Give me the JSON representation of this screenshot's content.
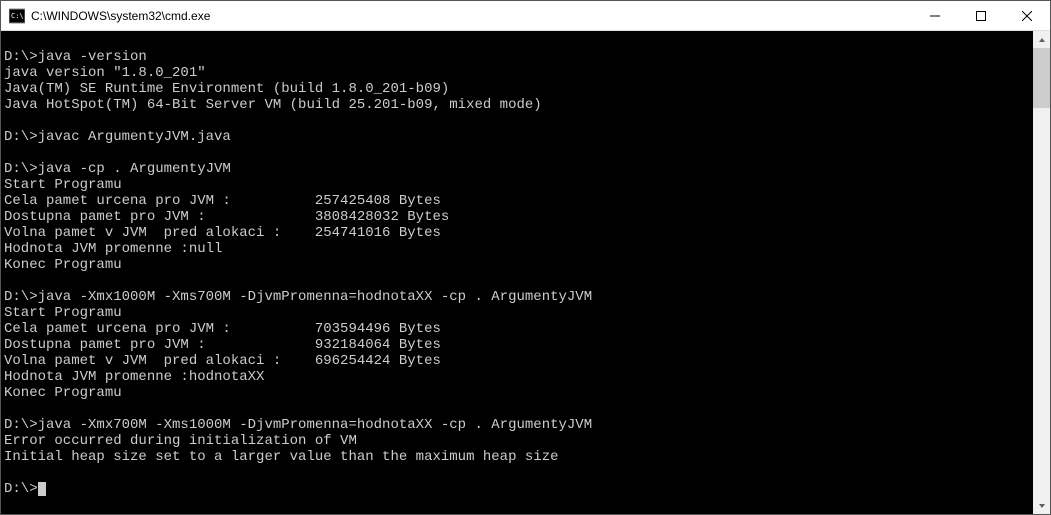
{
  "window": {
    "title": "C:\\WINDOWS\\system32\\cmd.exe"
  },
  "terminal": {
    "lines": [
      "",
      "D:\\>java -version",
      "java version \"1.8.0_201\"",
      "Java(TM) SE Runtime Environment (build 1.8.0_201-b09)",
      "Java HotSpot(TM) 64-Bit Server VM (build 25.201-b09, mixed mode)",
      "",
      "D:\\>javac ArgumentyJVM.java",
      "",
      "D:\\>java -cp . ArgumentyJVM",
      "Start Programu",
      "Cela pamet urcena pro JVM :          257425408 Bytes",
      "Dostupna pamet pro JVM :             3808428032 Bytes",
      "Volna pamet v JVM  pred alokaci :    254741016 Bytes",
      "Hodnota JVM promenne :null",
      "Konec Programu",
      "",
      "D:\\>java -Xmx1000M -Xms700M -DjvmPromenna=hodnotaXX -cp . ArgumentyJVM",
      "Start Programu",
      "Cela pamet urcena pro JVM :          703594496 Bytes",
      "Dostupna pamet pro JVM :             932184064 Bytes",
      "Volna pamet v JVM  pred alokaci :    696254424 Bytes",
      "Hodnota JVM promenne :hodnotaXX",
      "Konec Programu",
      "",
      "D:\\>java -Xmx700M -Xms1000M -DjvmPromenna=hodnotaXX -cp . ArgumentyJVM",
      "Error occurred during initialization of VM",
      "Initial heap size set to a larger value than the maximum heap size",
      "",
      "D:\\>"
    ]
  }
}
